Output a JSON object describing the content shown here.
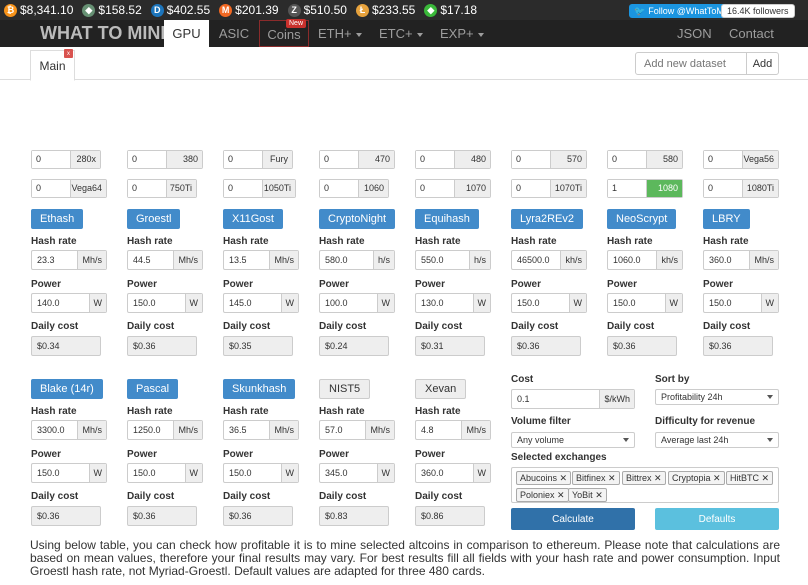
{
  "ticker": [
    {
      "icon": "bitcoin-icon",
      "glyph": "₿",
      "color": "#f7931a",
      "price": "$8,341.10"
    },
    {
      "icon": "ethereum-classic-icon",
      "glyph": "◆",
      "color": "#669073",
      "price": "$158.52"
    },
    {
      "icon": "dash-icon",
      "glyph": "D",
      "color": "#1c75bc",
      "price": "$402.55"
    },
    {
      "icon": "monero-icon",
      "glyph": "M",
      "color": "#f26822",
      "price": "$201.39"
    },
    {
      "icon": "zcash-icon",
      "glyph": "Z",
      "color": "#2b2b2b",
      "price": "$510.50"
    },
    {
      "icon": "litecoin-icon",
      "glyph": "Ł",
      "color": "#e8a33d",
      "price": "$233.55"
    },
    {
      "icon": "ethereum-classic-2-icon",
      "glyph": "◆",
      "color": "#3ab83a",
      "price": "$17.18"
    }
  ],
  "twitter": {
    "follow": "Follow @WhatToMine",
    "followers": "16.4K followers"
  },
  "nav": {
    "brand": "WHAT TO MINE",
    "gpu": "GPU",
    "asic": "ASIC",
    "coins": "Coins",
    "coins_badge": "New",
    "eth": "ETH+",
    "etc": "ETC+",
    "exp": "EXP+",
    "json": "JSON",
    "contact": "Contact"
  },
  "tabs": {
    "main": "Main",
    "close": "x",
    "dataset_placeholder": "Add new dataset",
    "add": "Add"
  },
  "gpus": [
    {
      "qty": "0",
      "name": "280x"
    },
    {
      "qty": "0",
      "name": "380"
    },
    {
      "qty": "0",
      "name": "Fury"
    },
    {
      "qty": "0",
      "name": "470"
    },
    {
      "qty": "0",
      "name": "480"
    },
    {
      "qty": "0",
      "name": "570"
    },
    {
      "qty": "0",
      "name": "580"
    },
    {
      "qty": "0",
      "name": "Vega56"
    },
    {
      "qty": "0",
      "name": "Vega64"
    },
    {
      "qty": "0",
      "name": "750Ti"
    },
    {
      "qty": "0",
      "name": "1050Ti"
    },
    {
      "qty": "0",
      "name": "1060"
    },
    {
      "qty": "0",
      "name": "1070"
    },
    {
      "qty": "0",
      "name": "1070Ti"
    },
    {
      "qty": "1",
      "name": "1080"
    },
    {
      "qty": "0",
      "name": "1080Ti"
    }
  ],
  "labels": {
    "hash_rate": "Hash rate",
    "power": "Power",
    "daily_cost": "Daily cost",
    "power_unit": "W"
  },
  "algos_row1": [
    {
      "name": "Ethash",
      "hash": "23.3",
      "unit": "Mh/s",
      "power": "140.0",
      "cost": "$0.34"
    },
    {
      "name": "Groestl",
      "hash": "44.5",
      "unit": "Mh/s",
      "power": "150.0",
      "cost": "$0.36"
    },
    {
      "name": "X11Gost",
      "hash": "13.5",
      "unit": "Mh/s",
      "power": "145.0",
      "cost": "$0.35"
    },
    {
      "name": "CryptoNight",
      "hash": "580.0",
      "unit": "h/s",
      "power": "100.0",
      "cost": "$0.24"
    },
    {
      "name": "Equihash",
      "hash": "550.0",
      "unit": "h/s",
      "power": "130.0",
      "cost": "$0.31"
    },
    {
      "name": "Lyra2REv2",
      "hash": "46500.0",
      "unit": "kh/s",
      "power": "150.0",
      "cost": "$0.36"
    },
    {
      "name": "NeoScrypt",
      "hash": "1060.0",
      "unit": "kh/s",
      "power": "150.0",
      "cost": "$0.36"
    },
    {
      "name": "LBRY",
      "hash": "360.0",
      "unit": "Mh/s",
      "power": "150.0",
      "cost": "$0.36"
    }
  ],
  "algos_row2": [
    {
      "name": "Blake (14r)",
      "hash": "3300.0",
      "unit": "Mh/s",
      "power": "150.0",
      "cost": "$0.36"
    },
    {
      "name": "Pascal",
      "hash": "1250.0",
      "unit": "Mh/s",
      "power": "150.0",
      "cost": "$0.36"
    },
    {
      "name": "Skunkhash",
      "hash": "36.5",
      "unit": "Mh/s",
      "power": "150.0",
      "cost": "$0.36"
    },
    {
      "name": "NIST5",
      "hash": "57.0",
      "unit": "Mh/s",
      "power": "345.0",
      "cost": "$0.83"
    },
    {
      "name": "Xevan",
      "hash": "4.8",
      "unit": "Mh/s",
      "power": "360.0",
      "cost": "$0.86"
    }
  ],
  "settings": {
    "cost_label": "Cost",
    "cost_value": "0.1",
    "cost_unit": "$/kWh",
    "sort_label": "Sort by",
    "sort_value": "Profitability 24h",
    "volume_label": "Volume filter",
    "volume_value": "Any volume",
    "difficulty_label": "Difficulty for revenue",
    "difficulty_value": "Average last 24h",
    "exchanges_label": "Selected exchanges",
    "exchanges": [
      "Abucoins",
      "Bitfinex",
      "Bittrex",
      "Cryptopia",
      "HitBTC",
      "Poloniex",
      "YoBit"
    ],
    "calculate": "Calculate",
    "defaults": "Defaults"
  },
  "description": "Using below table, you can check how profitable it is to mine selected altcoins in comparison to ethereum. Please note that calculations are based on mean values, therefore your final results may vary. For best results fill all fields with your hash rate and power consumption. Input Groestl hash rate, not Myriad-Groestl. Default values are adapted for three 480 cards.",
  "colors": {
    "primary": "#428bca",
    "success": "#5cb85c",
    "info": "#5bc0de",
    "navbar": "#222222"
  }
}
